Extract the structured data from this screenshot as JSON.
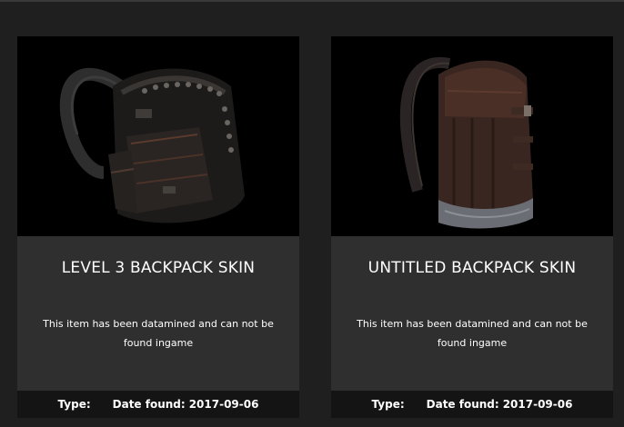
{
  "items": [
    {
      "title": "LEVEL 3 BACKPACK SKIN",
      "description": "This item has been datamined and can not be found ingame",
      "type_label": "Type:",
      "type_value": "",
      "date_label": "Date found:",
      "date_value": "2017-09-06",
      "image": "level-3-backpack-image"
    },
    {
      "title": "UNTITLED BACKPACK SKIN",
      "description": "This item has been datamined and can not be found ingame",
      "type_label": "Type:",
      "type_value": "",
      "date_label": "Date found:",
      "date_value": "2017-09-06",
      "image": "untitled-backpack-image"
    }
  ],
  "colors": {
    "page_background": "#1f1f1f",
    "card_background": "#2f2f2f",
    "image_background": "#000000",
    "footer_background": "#141414",
    "text": "#ffffff"
  }
}
